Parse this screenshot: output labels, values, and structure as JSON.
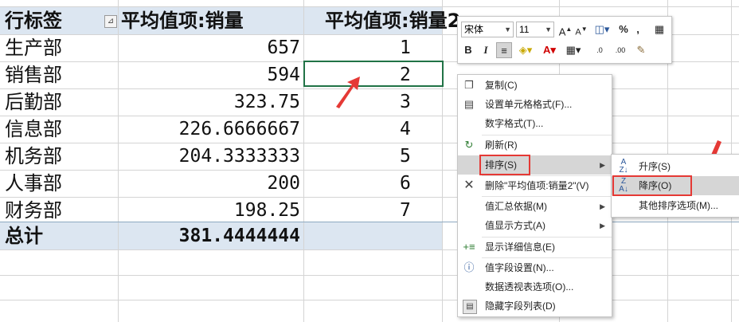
{
  "pivot": {
    "header": {
      "row_label": "行标签",
      "col1": "平均值项:销量",
      "col2": "平均值项:销量2"
    },
    "rows": [
      {
        "dept": "生产部",
        "avg": "657",
        "rank": "1"
      },
      {
        "dept": "销售部",
        "avg": "594",
        "rank": "2"
      },
      {
        "dept": "后勤部",
        "avg": "323.75",
        "rank": "3"
      },
      {
        "dept": "信息部",
        "avg": "226.6666667",
        "rank": "4"
      },
      {
        "dept": "机务部",
        "avg": "204.3333333",
        "rank": "5"
      },
      {
        "dept": "人事部",
        "avg": "200",
        "rank": "6"
      },
      {
        "dept": "财务部",
        "avg": "198.25",
        "rank": "7"
      }
    ],
    "total": {
      "label": "总计",
      "avg": "381.4444444"
    }
  },
  "mini_toolbar": {
    "font_name": "宋体",
    "font_size": "11",
    "icons": [
      "font-grow",
      "font-shrink",
      "accounting-format",
      "percent-style",
      "comma-style",
      "table-format",
      "bold",
      "italic",
      "align-center",
      "fill-color",
      "font-color",
      "borders",
      "increase-decimal",
      "decrease-decimal",
      "format-painter"
    ],
    "bold": "B",
    "italic": "I",
    "percent": "%",
    "comma": ","
  },
  "context_menu": {
    "items": [
      {
        "label": "复制(C)",
        "icon": "copy-icon"
      },
      {
        "label": "设置单元格格式(F)...",
        "icon": "format-cells-icon"
      },
      {
        "label": "数字格式(T)...",
        "icon": ""
      },
      {
        "label": "刷新(R)",
        "icon": "refresh-icon"
      },
      {
        "label": "排序(S)",
        "icon": "",
        "submenu": true,
        "highlighted": true
      },
      {
        "label": "删除\"平均值项:销量2\"(V)",
        "icon": "delete-icon"
      },
      {
        "label": "值汇总依据(M)",
        "icon": "",
        "submenu": true
      },
      {
        "label": "值显示方式(A)",
        "icon": "",
        "submenu": true
      },
      {
        "label": "显示详细信息(E)",
        "icon": "show-detail-icon"
      },
      {
        "label": "值字段设置(N)...",
        "icon": "field-settings-icon"
      },
      {
        "label": "数据透视表选项(O)...",
        "icon": ""
      },
      {
        "label": "隐藏字段列表(D)",
        "icon": "field-list-icon"
      }
    ]
  },
  "sort_submenu": {
    "items": [
      {
        "label": "升序(S)",
        "icon": "sort-ascending-icon"
      },
      {
        "label": "降序(O)",
        "icon": "sort-descending-icon",
        "highlighted": true
      },
      {
        "label": "其他排序选项(M)...",
        "icon": ""
      }
    ]
  },
  "colors": {
    "band": "#dce6f1",
    "selection": "#217346",
    "annotation": "#e53935",
    "menu_highlight": "#d6d6d6"
  }
}
